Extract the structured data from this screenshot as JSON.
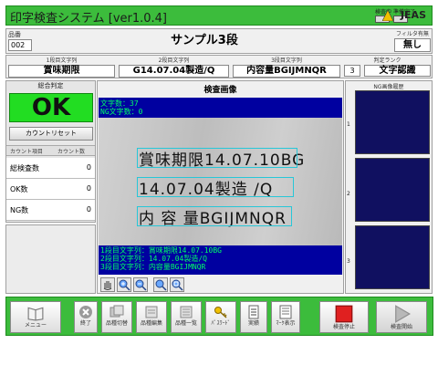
{
  "app": {
    "title": "印字検査システム [ver1.0.4]",
    "status_left": "検査中",
    "status_right": "準備完了",
    "logo": "JEAS"
  },
  "header": {
    "product_no_label": "品番",
    "product_no": "002",
    "product_name": "サンプル3段",
    "filter_label": "フィルタ有無",
    "filter_value": "無し"
  },
  "lines": [
    {
      "label": "1段目文字列",
      "value": "賞味期限"
    },
    {
      "label": "2段目文字列",
      "value": "G14.07.04製造/Q"
    },
    {
      "label": "3段目文字列",
      "value": "内容量BGIJMNQR"
    }
  ],
  "judgement_rank": {
    "label": "判定ランク",
    "rank": "3",
    "method": "文字認識"
  },
  "sidebar": {
    "overall_label": "総合判定",
    "result": "OK",
    "reset_button": "カウントリセット",
    "col_item": "カウント項目",
    "col_count": "カウント数",
    "counts": [
      {
        "label": "総検査数",
        "value": "0"
      },
      {
        "label": "OK数",
        "value": "0"
      },
      {
        "label": "NG数",
        "value": "0"
      }
    ]
  },
  "image_panel": {
    "title": "検査画像",
    "overlay_top": [
      "文字数：37",
      "NG文字数：0"
    ],
    "ocr_lines": [
      "賞味期限14.07.10BG",
      "14.07.04製造 /Q",
      "内 容 量BGIJMNQR"
    ],
    "overlay_bottom": [
      "1段目文字列：賞味期限14.07.10BG",
      "2段目文字列：14.07.04製造/Q",
      "3段目文字列：内容量BGIJMNQR"
    ]
  },
  "ng_history": {
    "title": "NG画像履歴",
    "slots": [
      "1",
      "2",
      "3"
    ]
  },
  "toolbar": {
    "menu": "メニュー",
    "exit": "終了",
    "switch": "品種切替",
    "edit": "品種編集",
    "list": "品種一覧",
    "password": "ﾊﾟｽﾜｰﾄﾞ",
    "record": "実績",
    "mark": "ﾏｰｸ表示",
    "stop": "検査停止",
    "start": "検査開始"
  },
  "colors": {
    "accent_green": "#3cbc3c",
    "ok_green": "#22dd22",
    "image_overlay": "#0000a0",
    "stop_red": "#e02020"
  }
}
